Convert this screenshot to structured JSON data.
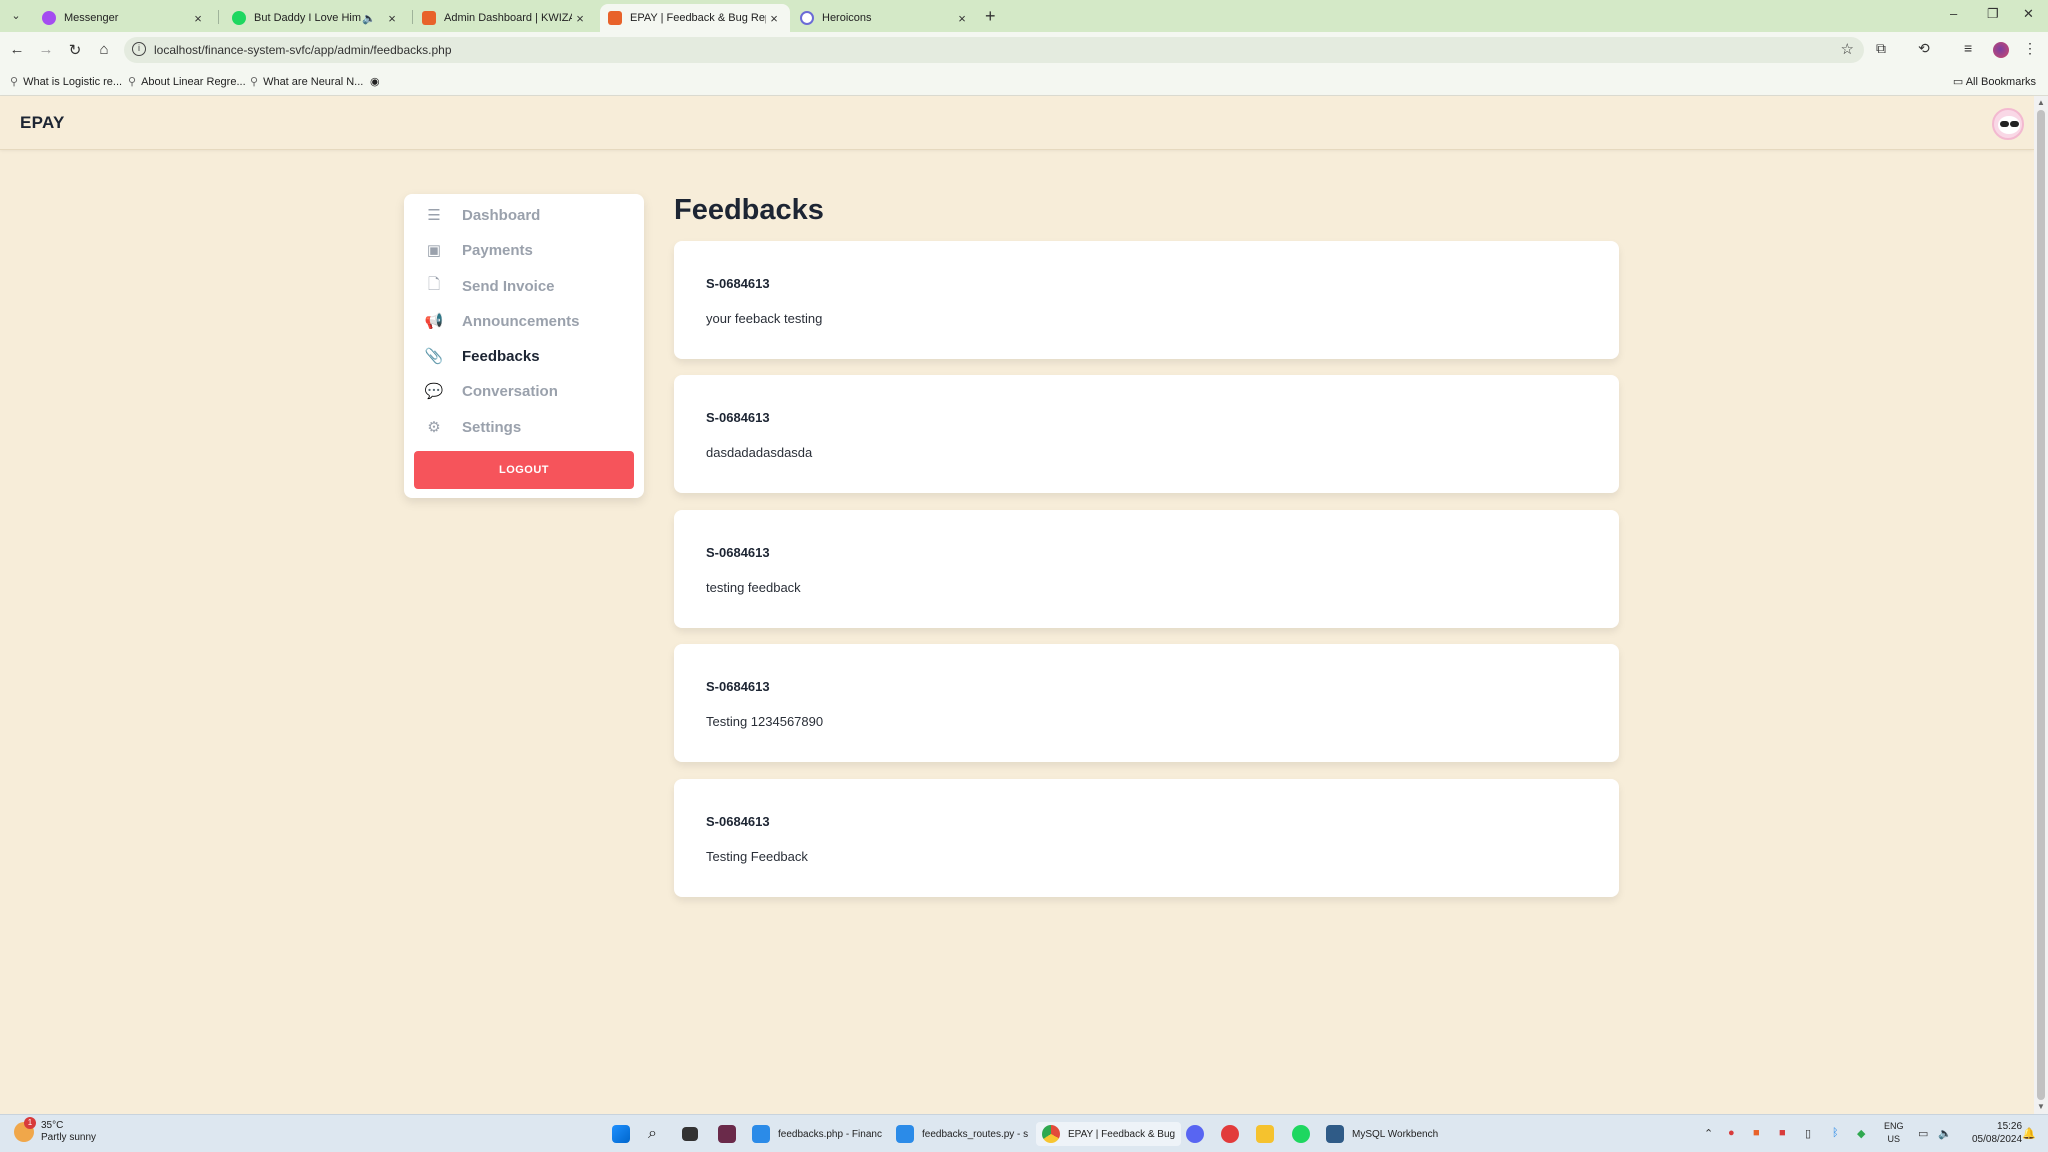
{
  "browser": {
    "tabs": [
      {
        "title": "Messenger",
        "color": "#a44cf0"
      },
      {
        "title": "But Daddy I Love Him • Ta",
        "color": "#1ed760"
      },
      {
        "title": "Admin Dashboard | KWIZANIA",
        "color": "#e8622a"
      },
      {
        "title": "EPAY | Feedback & Bug Report",
        "color": "#e8622a"
      },
      {
        "title": "Heroicons",
        "color": "#6b6bd6"
      }
    ],
    "url": "localhost/finance-system-svfc/app/admin/feedbacks.php",
    "bookmarks": [
      "What is Logistic re...",
      "About Linear Regre...",
      "What are Neural N..."
    ],
    "all_bookmarks": "All Bookmarks"
  },
  "app": {
    "brand": "EPAY",
    "page_title": "Feedbacks",
    "nav": [
      {
        "label": "Dashboard",
        "icon": "menu-icon"
      },
      {
        "label": "Payments",
        "icon": "wallet-icon"
      },
      {
        "label": "Send Invoice",
        "icon": "document-icon"
      },
      {
        "label": "Announcements",
        "icon": "megaphone-icon"
      },
      {
        "label": "Feedbacks",
        "icon": "paperclip-icon"
      },
      {
        "label": "Conversation",
        "icon": "chat-icon"
      },
      {
        "label": "Settings",
        "icon": "cog-icon"
      }
    ],
    "active_nav": "Feedbacks",
    "logout": "LOGOUT",
    "feedbacks": [
      {
        "id": "S-0684613",
        "message": "your feeback testing"
      },
      {
        "id": "S-0684613",
        "message": "dasdadadasdasda"
      },
      {
        "id": "S-0684613",
        "message": "testing feedback"
      },
      {
        "id": "S-0684613",
        "message": "Testing 1234567890"
      },
      {
        "id": "S-0684613",
        "message": "Testing Feedback"
      }
    ]
  },
  "taskbar": {
    "weather_temp": "35°C",
    "weather_desc": "Partly sunny",
    "weather_badge": "1",
    "apps": [
      {
        "label": "feedbacks.php - Financ",
        "color": "#2b8be8"
      },
      {
        "label": "feedbacks_routes.py - s",
        "color": "#2b8be8"
      },
      {
        "label": "EPAY | Feedback & Bug",
        "color": "#e24b3b"
      },
      {
        "label": "MySQL Workbench",
        "color": "#2f5b87"
      }
    ],
    "lang": "ENG",
    "region": "US",
    "time": "15:26",
    "date": "05/08/2024"
  },
  "colors": {
    "page_bg": "#f7edd9",
    "accent_logout": "#f6545b",
    "active_text": "#1d2533",
    "inactive_text": "#9aa1ac"
  }
}
